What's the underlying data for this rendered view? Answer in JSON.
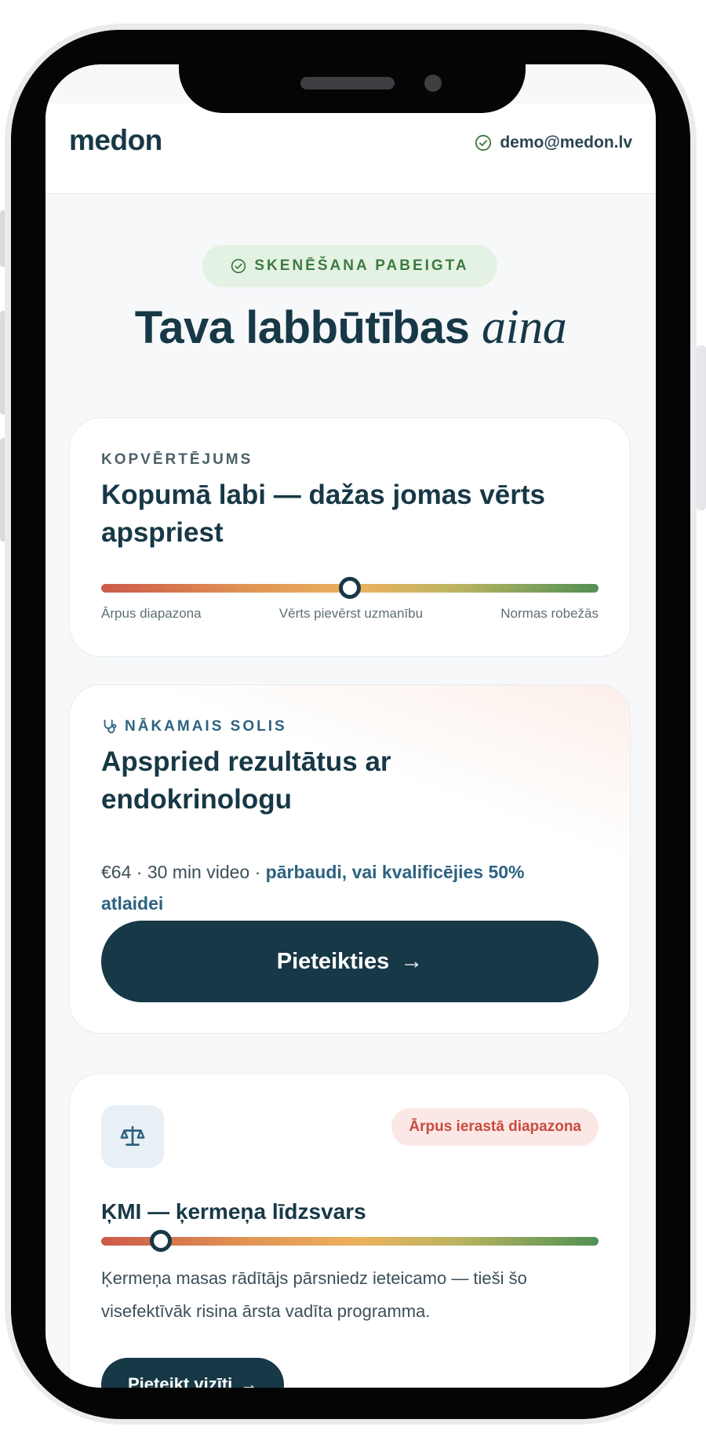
{
  "header": {
    "logo": "medon",
    "user_email": "demo@medon.lv"
  },
  "status_badge": "SKENĒŠANA PABEIGTA",
  "title": {
    "main": "Tava labbūtības",
    "accent": "aina"
  },
  "overall": {
    "eyebrow": "KOPVĒRTĒJUMS",
    "headline": "Kopumā labi — dažas jomas vērts apspriest",
    "marker_position": 0.5,
    "range_labels": [
      "Ārpus diapazona",
      "Vērts pievērst uzmanību",
      "Normas robežās"
    ]
  },
  "next_step": {
    "eyebrow": "NĀKAMAIS SOLIS",
    "headline": "Apspried rezultātus ar endokrinologu",
    "price": "€64 · 30 min video · ",
    "discount_link": "pārbaudi, vai kvalificējies 50% atlaidei",
    "cta_label": "Pieteikties",
    "cta_arrow": "→"
  },
  "bmi": {
    "icon": "scale-icon",
    "badge": "Ārpus ierastā diapazona",
    "title": "ĶMI — ķermeņa līdzsvars",
    "marker_position": 0.12,
    "description": "Ķermeņa masas rādītājs pārsniedz ieteicamo — tieši šo visefektīvāk risina ārsta vadīta programma.",
    "button_label": "Pieteikt vizīti",
    "button_arrow": "→"
  },
  "colors": {
    "brand_dark": "#173846",
    "success": "#3d7a40",
    "alert": "#c84b3e"
  }
}
